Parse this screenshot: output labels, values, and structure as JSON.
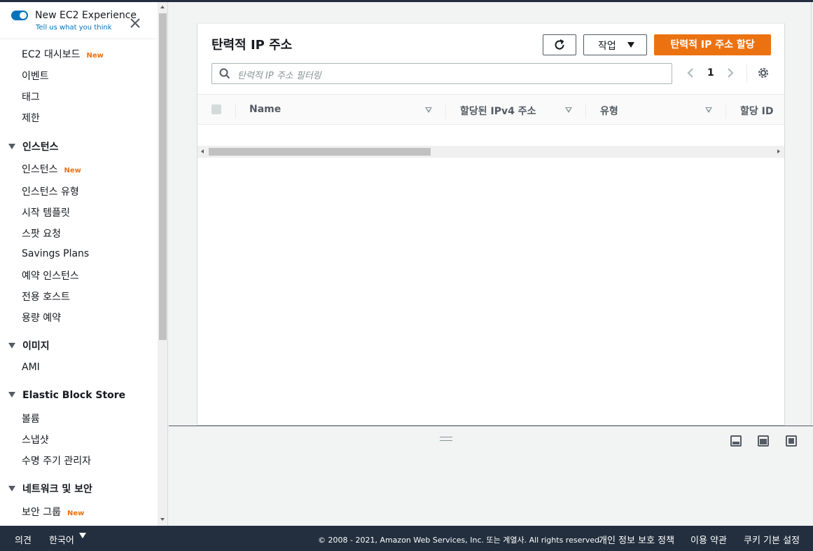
{
  "experience": {
    "title": "New EC2 Experience",
    "link": "Tell us what you think"
  },
  "sidebar": {
    "badge_new": "New",
    "items": [
      {
        "label": "EC2 대시보드",
        "new": true
      },
      {
        "label": "이벤트"
      },
      {
        "label": "태그"
      },
      {
        "label": "제한"
      }
    ],
    "sections": [
      {
        "title": "인스턴스",
        "items": [
          "인스턴스",
          "인스턴스 유형",
          "시작 템플릿",
          "스팟 요청",
          "Savings Plans",
          "예약 인스턴스",
          "전용 호스트",
          "용량 예약"
        ]
      },
      {
        "title": "이미지",
        "items": [
          "AMI"
        ]
      },
      {
        "title": "Elastic Block Store",
        "items": [
          "볼륨",
          "스냅샷",
          "수명 주기 관리자"
        ]
      },
      {
        "title": "네트워크 및 보안",
        "items": [
          "보안 그룹"
        ]
      }
    ]
  },
  "panel": {
    "title": "탄력적 IP 주소",
    "actions_label": "작업",
    "primary_label": "탄력적 IP 주소 할당",
    "search_placeholder": "탄력적 IP 주소 필터링",
    "page": "1",
    "columns": [
      "Name",
      "할당된 IPv4 주소",
      "유형",
      "할당 ID"
    ]
  },
  "footer": {
    "feedback": "의견",
    "language": "한국어",
    "copyright": "© 2008 - 2021, Amazon Web Services, Inc. 또는 계열사. All rights reserved.",
    "privacy": "개인 정보 보호 정책",
    "terms": "이용 약관",
    "cookie": "쿠키 기본 설정"
  },
  "colors": {
    "accent": "#ec7211",
    "link": "#0073bb",
    "footer_bg": "#232f3e"
  }
}
